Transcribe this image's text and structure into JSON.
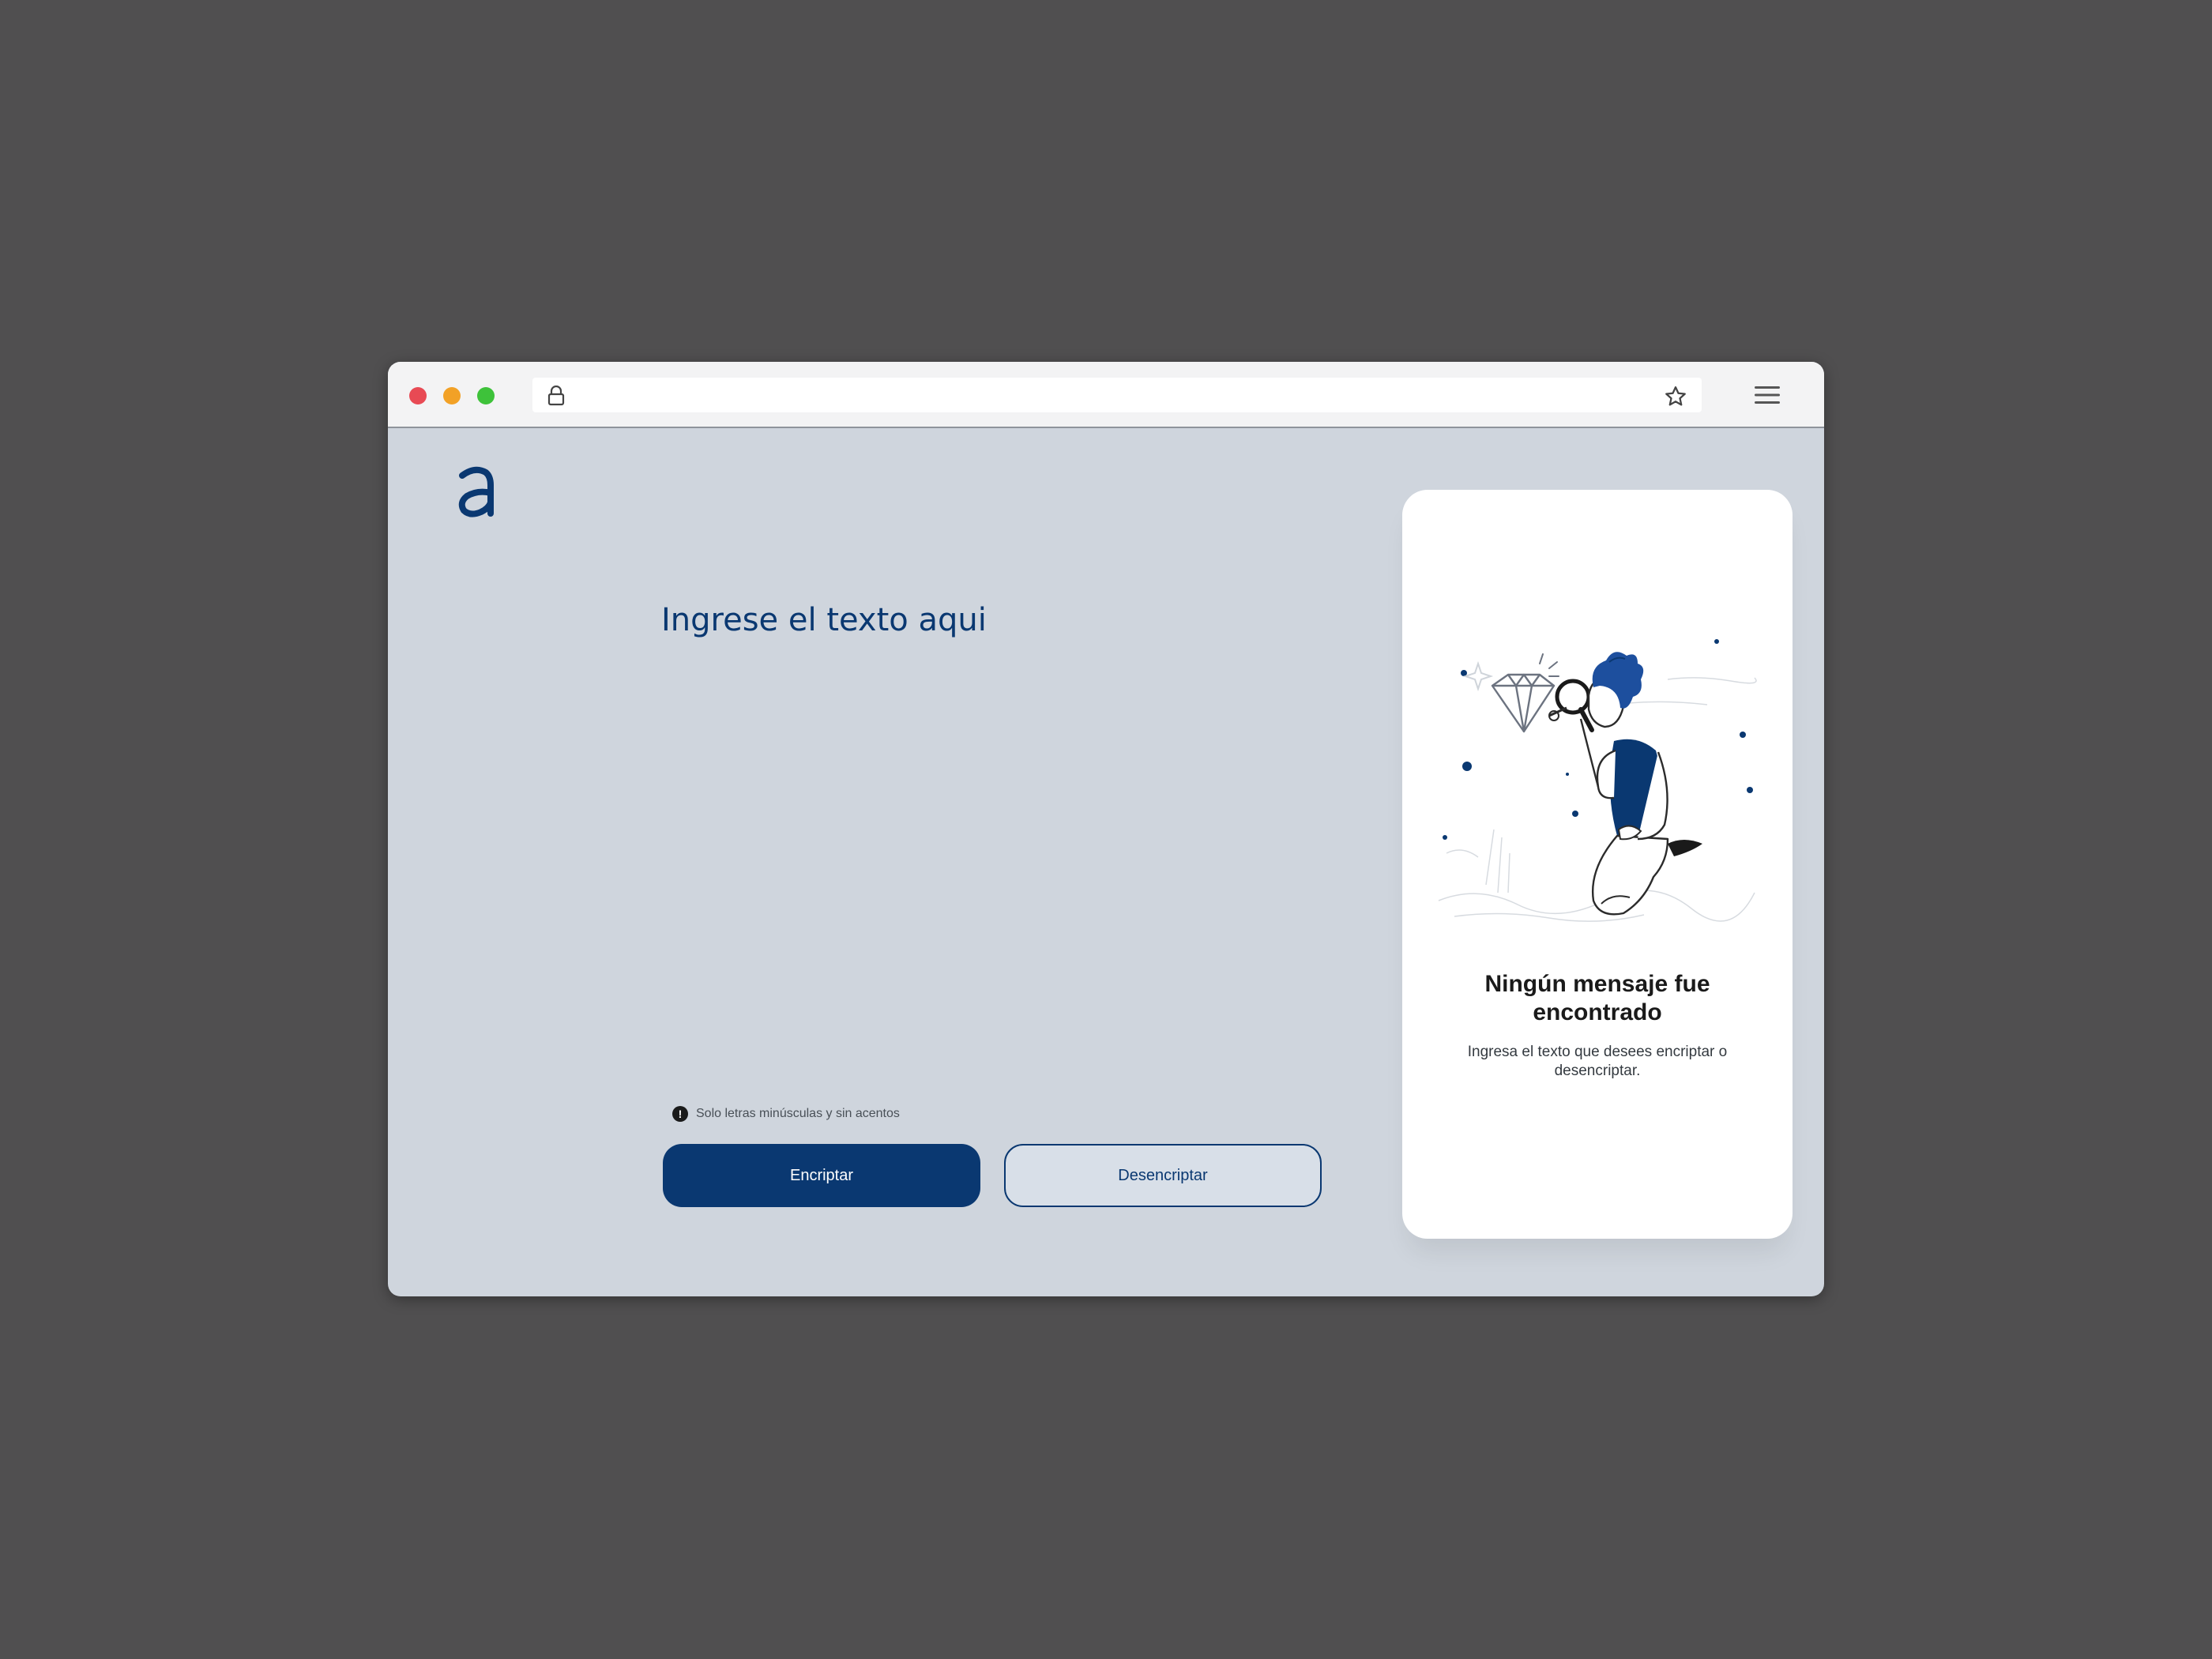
{
  "browser": {
    "url": "",
    "icons": {
      "lock": "lock-icon",
      "bookmark": "star-icon",
      "menu": "hamburger-menu-icon"
    }
  },
  "logo": {
    "icon": "alura-a-logo"
  },
  "editor": {
    "placeholder": "Ingrese el texto aqui",
    "value": ""
  },
  "hint": {
    "icon": "info-icon",
    "text": "Solo letras minúsculas y sin acentos"
  },
  "buttons": {
    "encrypt": "Encriptar",
    "decrypt": "Desencriptar"
  },
  "output": {
    "title": "Ningún mensaje fue encontrado",
    "message": "Ingresa el texto que desees encriptar o desencriptar.",
    "illustration": "person-with-magnifier-and-diamond-illustration"
  },
  "colors": {
    "primary": "#0a3871",
    "background": "#cfd5dd",
    "card": "#ffffff",
    "desktop": "#504f50"
  }
}
